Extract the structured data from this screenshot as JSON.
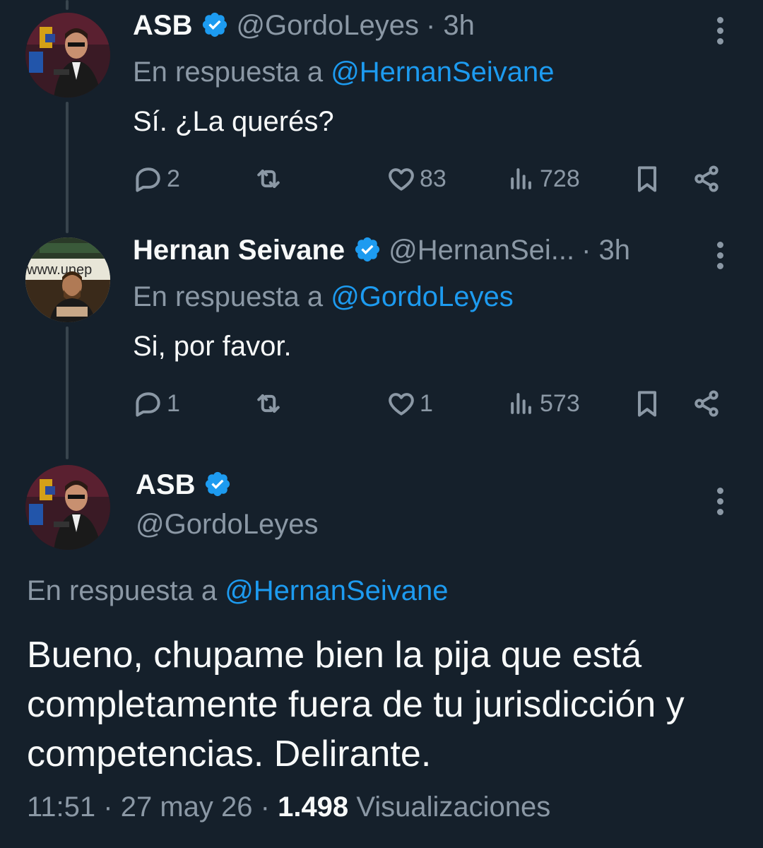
{
  "tweets": [
    {
      "name": "ASB",
      "handle": "@GordoLeyes",
      "time": "· 3h",
      "reply_prefix": "En respuesta a ",
      "reply_to": "@HernanSeivane",
      "text": "Sí. ¿La querés?",
      "replies": "2",
      "likes": "83",
      "views": "728"
    },
    {
      "name": "Hernan Seivane",
      "handle": "@HernanSei...",
      "time": "· 3h",
      "reply_prefix": "En respuesta a ",
      "reply_to": "@GordoLeyes",
      "text": "Si, por favor.",
      "replies": "1",
      "likes": "1",
      "views": "573",
      "avatar_text": "www.unep"
    }
  ],
  "main": {
    "name": "ASB",
    "handle": "@GordoLeyes",
    "reply_prefix": "En respuesta a ",
    "reply_to": "@HernanSeivane",
    "text": "Bueno, chupame bien la pija que está completamente fuera de tu jurisdicción y competencias. Delirante.",
    "time": "11:51",
    "sep1": "·",
    "date": "27 may 26",
    "sep2": "·",
    "views": "1.498",
    "views_label": "Visualizaciones"
  },
  "colors": {
    "background": "#15202b",
    "accent": "#1d9bf0",
    "secondary_text": "#8b98a5",
    "thread_line": "#38444d"
  },
  "icons": [
    "reply-icon",
    "retweet-icon",
    "like-icon",
    "views-icon",
    "bookmark-icon",
    "share-icon",
    "verified-badge-icon",
    "more-icon"
  ]
}
